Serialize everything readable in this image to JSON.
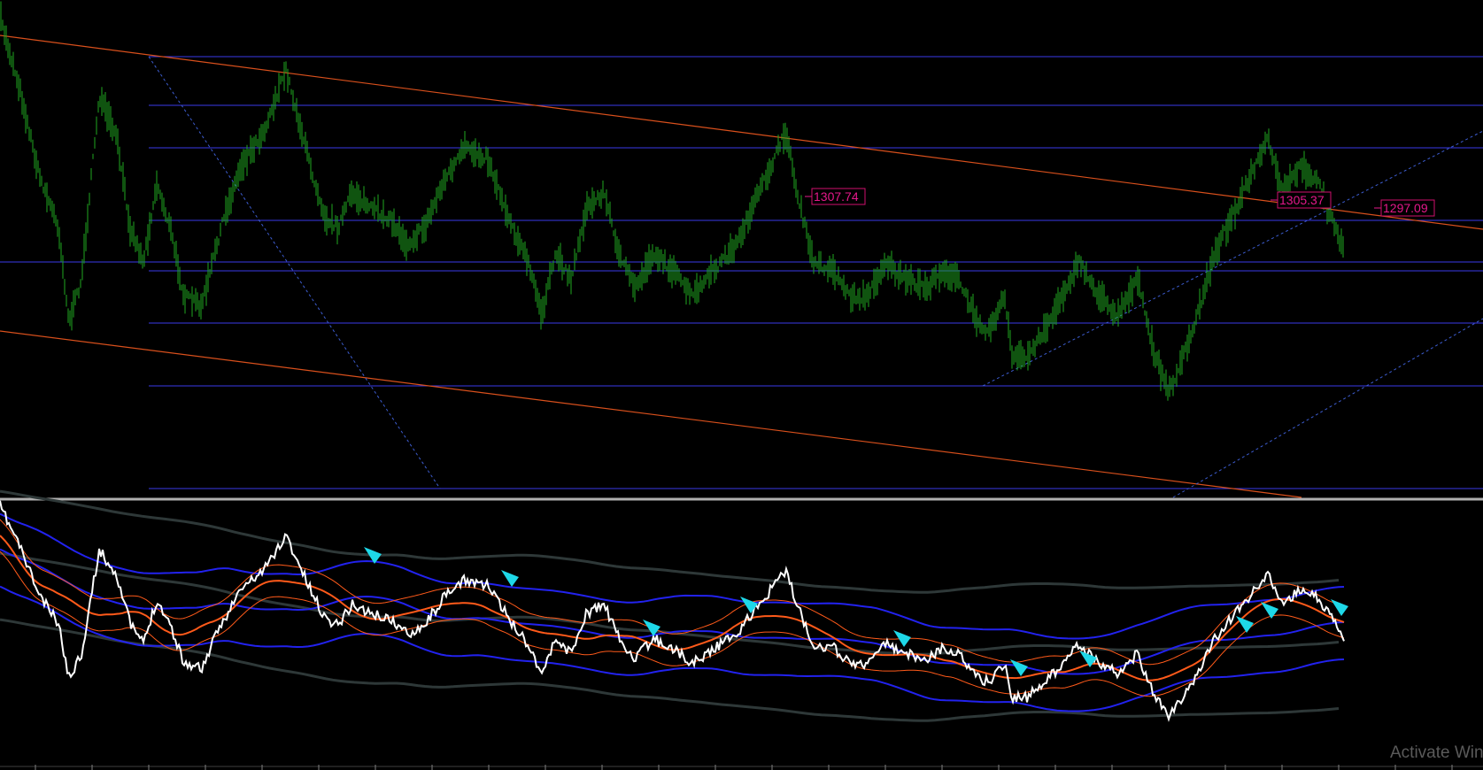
{
  "colors": {
    "background": "#000000",
    "candles": "#1fa81f",
    "horizontal_levels": "#3a3ae8",
    "channel": "#d9501c",
    "trend_dotted": "#3c5ccf",
    "panel_separator": "#b0b0b0",
    "price_tag": "#e4188a",
    "osc_main": "#ffffff",
    "osc_fast": "#ff5a1a",
    "osc_envelope": "#2222ee",
    "osc_slow": "#2e3838",
    "arrow_marker": "#1ed8e8",
    "watermark": "#5a5a5a"
  },
  "price_tags": [
    {
      "label": "1307.74"
    },
    {
      "label": "1305.37"
    },
    {
      "label": "1297.09"
    }
  ],
  "arrow_marker_icon": "cyan-arrow-down-icon",
  "watermark": {
    "text": "Activate Windows"
  },
  "chart_data": {
    "type": "line",
    "title": "",
    "xlabel": "",
    "ylabel": "",
    "series": [
      {
        "values": [
          1320,
          1312,
          1302,
          1296,
          1285,
          1290,
          1311,
          1306,
          1296,
          1292,
          1301,
          1296,
          1288,
          1287,
          1296,
          1303,
          1307,
          1314,
          1308,
          1302,
          1297,
          1296,
          1300,
          1298,
          1297,
          1294,
          1296,
          1301,
          1305,
          1304,
          1297,
          1292,
          1286,
          1293,
          1290,
          1298,
          1300,
          1292,
          1289,
          1293,
          1291,
          1288,
          1291,
          1294,
          1307,
          1301,
          1292,
          1291,
          1288,
          1288,
          1292,
          1290,
          1289,
          1291,
          1290,
          1286,
          1284,
          1288,
          1281,
          1281,
          1286,
          1292,
          1288,
          1286,
          1290,
          1282,
          1277,
          1283,
          1293,
          1306,
          1300,
          1303,
          1301,
          1293
        ]
      }
    ]
  }
}
